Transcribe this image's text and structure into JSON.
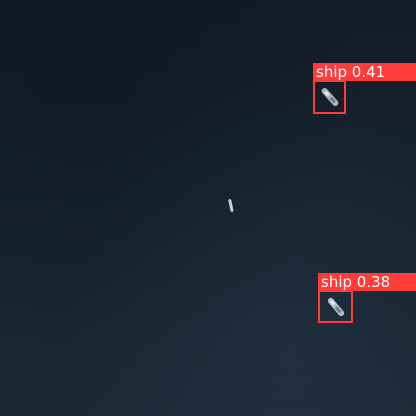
{
  "image": {
    "type": "satellite ocean scene with object detections",
    "background_color": "#16222f"
  },
  "detections": [
    {
      "class_label": "ship 0.41",
      "box_color": "#ff3b3b"
    },
    {
      "class_label": "ship 0.38",
      "box_color": "#ff3b3b"
    }
  ],
  "undetected_objects": [
    {
      "kind": "ship"
    }
  ]
}
